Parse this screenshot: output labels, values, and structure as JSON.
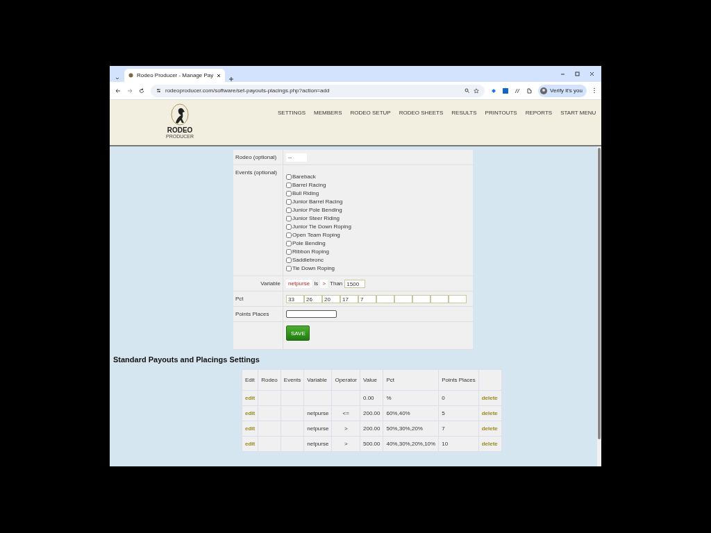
{
  "browser": {
    "tab_title": "Rodeo Producer - Manage Pay",
    "url": "rodeoproducer.com/software/set-payouts-placings.php?action=add",
    "profile_label": "Verify it's you"
  },
  "header": {
    "logo_word": "RODEO",
    "logo_subword": "PRODUCER",
    "nav": [
      "SETTINGS",
      "MEMBERS",
      "RODEO SETUP",
      "RODEO SHEETS",
      "RESULTS",
      "PRINTOUTS",
      "REPORTS",
      "START MENU"
    ]
  },
  "form": {
    "rodeo": {
      "label": "Rodeo (optional)",
      "value": "--"
    },
    "events": {
      "label": "Events (optional)",
      "items": [
        {
          "label": "Bareback",
          "checked": false
        },
        {
          "label": "Barrel Racing",
          "checked": false
        },
        {
          "label": "Bull Riding",
          "checked": false
        },
        {
          "label": "Junior Barrel Racing",
          "checked": false
        },
        {
          "label": "Junior Pole Bending",
          "checked": false
        },
        {
          "label": "Junior Steer Riding",
          "checked": false
        },
        {
          "label": "Junior Tie Down Roping",
          "checked": false
        },
        {
          "label": "Open Team Roping",
          "checked": false
        },
        {
          "label": "Pole Bending",
          "checked": false
        },
        {
          "label": "Ribbon Roping",
          "checked": false
        },
        {
          "label": "Saddlebronc",
          "checked": false
        },
        {
          "label": "Tie Down Roping",
          "checked": false
        }
      ]
    },
    "variable": {
      "label": "Variable",
      "value": "netpurse",
      "is_label": "Is",
      "operator": ">",
      "than_label": "Than",
      "amount": "1500"
    },
    "pct": {
      "label": "Pct",
      "values": [
        "33",
        "26",
        "20",
        "17",
        "7"
      ]
    },
    "points_places": {
      "label": "Points Places"
    },
    "save_button": "SAVE"
  },
  "settings": {
    "heading": "Standard Payouts and Placings Settings",
    "table": {
      "columns": [
        "Edit",
        "Rodeo",
        "Events",
        "Variable",
        "Operator",
        "Value",
        "Pct",
        "Points Places"
      ],
      "rows": [
        {
          "edit": "edit",
          "variable": "",
          "operator": "",
          "value": "0.00",
          "pct": "%",
          "points_places": "0",
          "delete": "delete"
        },
        {
          "edit": "edit",
          "variable": "netpurse",
          "operator": "<=",
          "value": "200.00",
          "pct": "60%,40%",
          "points_places": "5",
          "delete": "delete"
        },
        {
          "edit": "edit",
          "variable": "netpurse",
          "operator": ">",
          "value": "200.00",
          "pct": "50%,30%,20%",
          "points_places": "7",
          "delete": "delete"
        },
        {
          "edit": "edit",
          "variable": "netpurse",
          "operator": ">",
          "value": "500.00",
          "pct": "40%,30%,20%,10%",
          "points_places": "10",
          "delete": "delete"
        }
      ]
    }
  }
}
